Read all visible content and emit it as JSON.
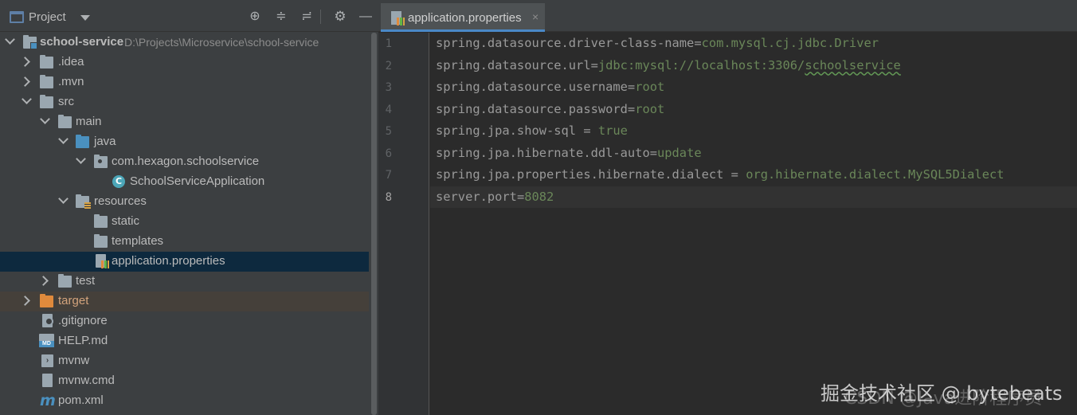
{
  "project_panel": {
    "title": "Project",
    "header_icons": [
      "project-view-icon",
      "dropdown-icon",
      "locate-icon",
      "expand-all-icon",
      "collapse-all-icon",
      "gear-icon",
      "hide-icon"
    ]
  },
  "tree": [
    {
      "label": "school-service",
      "path": "D:\\Projects\\Microservice\\school-service",
      "icon": "module-folder-icon",
      "state": "expanded"
    },
    {
      "label": ".idea",
      "icon": "folder-icon",
      "state": "collapsed"
    },
    {
      "label": ".mvn",
      "icon": "folder-icon",
      "state": "collapsed"
    },
    {
      "label": "src",
      "icon": "folder-icon",
      "state": "expanded"
    },
    {
      "label": "main",
      "icon": "folder-icon",
      "state": "expanded"
    },
    {
      "label": "java",
      "icon": "source-folder-icon",
      "state": "expanded"
    },
    {
      "label": "com.hexagon.schoolservice",
      "icon": "package-icon",
      "state": "expanded"
    },
    {
      "label": "SchoolServiceApplication",
      "icon": "spring-class-icon",
      "state": "leaf"
    },
    {
      "label": "resources",
      "icon": "resources-folder-icon",
      "state": "expanded"
    },
    {
      "label": "static",
      "icon": "folder-icon",
      "state": "leaf"
    },
    {
      "label": "templates",
      "icon": "folder-icon",
      "state": "leaf"
    },
    {
      "label": "application.properties",
      "icon": "properties-file-icon",
      "state": "selected"
    },
    {
      "label": "test",
      "icon": "folder-icon",
      "state": "collapsed"
    },
    {
      "label": "target",
      "icon": "excluded-folder-icon",
      "state": "collapsed"
    },
    {
      "label": ".gitignore",
      "icon": "gitignore-file-icon",
      "state": "leaf"
    },
    {
      "label": "HELP.md",
      "icon": "markdown-file-icon",
      "state": "leaf"
    },
    {
      "label": "mvnw",
      "icon": "shell-file-icon",
      "state": "leaf"
    },
    {
      "label": "mvnw.cmd",
      "icon": "cmd-file-icon",
      "state": "leaf"
    },
    {
      "label": "pom.xml",
      "icon": "maven-file-icon",
      "state": "leaf"
    }
  ],
  "editor": {
    "tab": {
      "label": "application.properties",
      "close": "×"
    },
    "current_line": 8,
    "lines": [
      {
        "num": "1",
        "key": "spring.datasource.driver-class-name",
        "sep": "=",
        "value": "com.mysql.cj.jdbc.Driver"
      },
      {
        "num": "2",
        "key": "spring.datasource.url",
        "sep": "=",
        "value": "jdbc:mysql://localhost:3306/",
        "value_underlined": "schoolservice"
      },
      {
        "num": "3",
        "key": "spring.datasource.username",
        "sep": "=",
        "value": "root"
      },
      {
        "num": "4",
        "key": "spring.datasource.password",
        "sep": "=",
        "value": "root"
      },
      {
        "num": "5",
        "key": "spring.jpa.show-sql",
        "sep": " = ",
        "value": "true"
      },
      {
        "num": "6",
        "key": "spring.jpa.hibernate.ddl-auto",
        "sep": "=",
        "value": "update"
      },
      {
        "num": "7",
        "key": "spring.jpa.properties.hibernate.dialect",
        "sep": " = ",
        "value": "org.hibernate.dialect.MySQL5Dialect"
      },
      {
        "num": "8",
        "key": "server.port",
        "sep": "=",
        "value": "8082"
      }
    ]
  },
  "colors": {
    "panel_bg": "#3c3f41",
    "editor_bg": "#2b2b2b",
    "selection": "#0d293e",
    "excluded_bg": "#45403a",
    "property_key": "#cc7832",
    "property_value": "#6a8759",
    "tab_underline": "#4a88c7"
  },
  "watermark": {
    "text1": "掘金技术社区 @ bytebeats",
    "text2": "CSDN @Java进阶程序员"
  }
}
